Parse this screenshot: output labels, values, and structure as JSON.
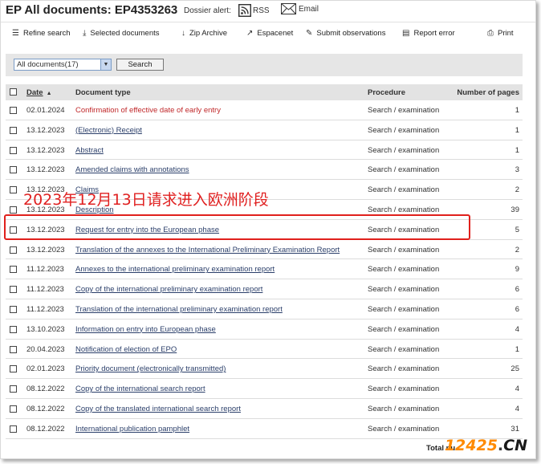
{
  "header": {
    "title": "EP All documents: EP4353263",
    "dossier_alert_label": "Dossier alert:",
    "rss_label": "RSS",
    "email_label": "Email"
  },
  "toolbar": {
    "refine_search": "Refine search",
    "selected_documents": "Selected documents",
    "zip_archive": "Zip Archive",
    "espacenet": "Espacenet",
    "submit_observations": "Submit observations",
    "report_error": "Report error",
    "print": "Print"
  },
  "filter": {
    "selected": "All documents(17)",
    "search_button": "Search"
  },
  "table": {
    "headers": {
      "date": "Date",
      "document_type": "Document type",
      "procedure": "Procedure",
      "pages": "Number of pages"
    },
    "rows": [
      {
        "date": "02.01.2024",
        "doc": "Confirmation of effective date of early entry",
        "procedure": "Search / examination",
        "pages": "1"
      },
      {
        "date": "13.12.2023",
        "doc": "(Electronic) Receipt",
        "procedure": "Search / examination",
        "pages": "1"
      },
      {
        "date": "13.12.2023",
        "doc": "Abstract",
        "procedure": "Search / examination",
        "pages": "1"
      },
      {
        "date": "13.12.2023",
        "doc": "Amended claims with annotations",
        "procedure": "Search / examination",
        "pages": "3"
      },
      {
        "date": "13.12.2023",
        "doc": "Claims",
        "procedure": "Search / examination",
        "pages": "2"
      },
      {
        "date": "13.12.2023",
        "doc": "Description",
        "procedure": "Search / examination",
        "pages": "39"
      },
      {
        "date": "13.12.2023",
        "doc": "Request for entry into the European phase",
        "procedure": "Search / examination",
        "pages": "5"
      },
      {
        "date": "13.12.2023",
        "doc": "Translation of the annexes to the International Preliminary Examination Report",
        "procedure": "Search / examination",
        "pages": "2"
      },
      {
        "date": "11.12.2023",
        "doc": "Annexes to the international preliminary examination report",
        "procedure": "Search / examination",
        "pages": "9"
      },
      {
        "date": "11.12.2023",
        "doc": "Copy of the international preliminary examination report",
        "procedure": "Search / examination",
        "pages": "6"
      },
      {
        "date": "11.12.2023",
        "doc": "Translation of the international preliminary examination report",
        "procedure": "Search / examination",
        "pages": "6"
      },
      {
        "date": "13.10.2023",
        "doc": "Information on entry into European phase",
        "procedure": "Search / examination",
        "pages": "4"
      },
      {
        "date": "20.04.2023",
        "doc": "Notification of election of EPO",
        "procedure": "Search / examination",
        "pages": "1"
      },
      {
        "date": "02.01.2023",
        "doc": "Priority document (electronically transmitted)",
        "procedure": "Search / examination",
        "pages": "25"
      },
      {
        "date": "08.12.2022",
        "doc": "Copy of the international search report",
        "procedure": "Search / examination",
        "pages": "4"
      },
      {
        "date": "08.12.2022",
        "doc": "Copy of the translated international search report",
        "procedure": "Search / examination",
        "pages": "4"
      },
      {
        "date": "08.12.2022",
        "doc": "International publication pamphlet",
        "procedure": "Search / examination",
        "pages": "31"
      }
    ]
  },
  "footer": {
    "total": "Total nu"
  },
  "annotation": {
    "text": "2023年12月13日请求进入欧洲阶段"
  },
  "watermark": {
    "number": "12425",
    "dot": ".",
    "suffix": "CN"
  },
  "colors": {
    "link": "#2b3f6a",
    "highlight_red": "#c0282a",
    "annotation_red": "#e0201c",
    "watermark_orange": "#ff8a00"
  }
}
